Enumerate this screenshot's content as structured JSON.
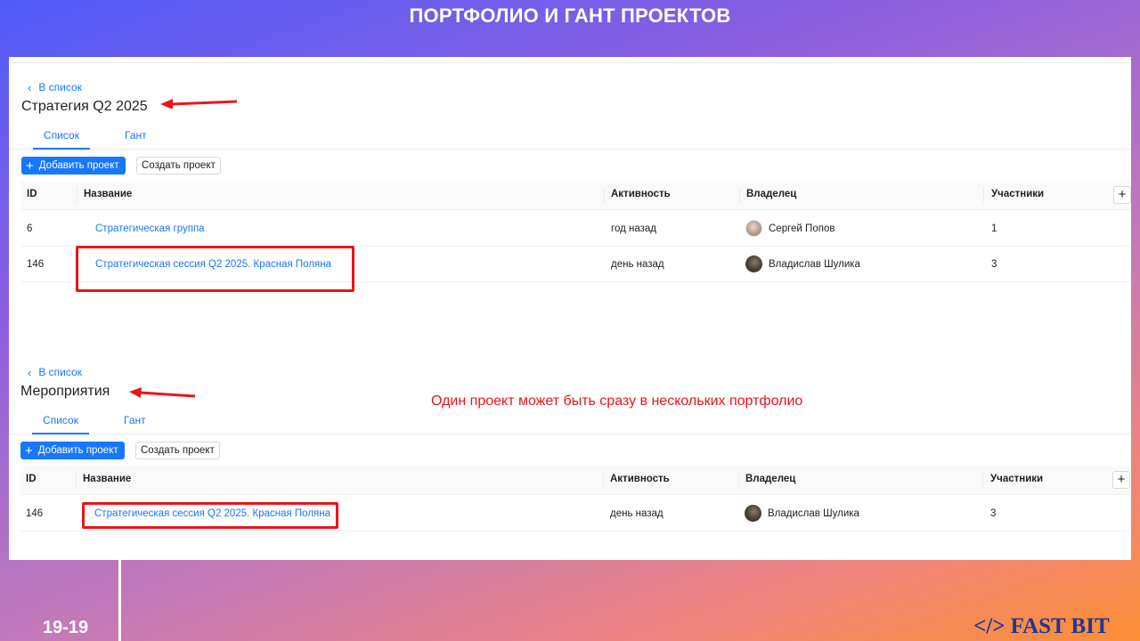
{
  "slide": {
    "title": "ПОРТФОЛИО И ГАНТ ПРОЕКТОВ",
    "page_number": "19-19",
    "brand": "</> FAST BIT",
    "note": "Один проект может быть сразу в нескольких портфолио"
  },
  "table_columns": {
    "id": "ID",
    "name": "Название",
    "activity": "Активность",
    "owner": "Владелец",
    "participants": "Участники",
    "add_column": "+"
  },
  "sections": [
    {
      "back_label": "В список",
      "title": "Стратегия Q2 2025",
      "tabs": [
        {
          "label": "Список",
          "active": true
        },
        {
          "label": "Гант",
          "active": false
        }
      ],
      "add_project_label": "Добавить проект",
      "create_project_label": "Создать проект",
      "rows": [
        {
          "id": "6",
          "name": "Стратегическая группа",
          "activity": "год назад",
          "owner": "Сергей Попов",
          "owner_avatar": "light",
          "participants": "1"
        },
        {
          "id": "146",
          "name": "Стратегическая сессия Q2 2025. Красная Поляна",
          "activity": "день назад",
          "owner": "Владислав Шулика",
          "owner_avatar": "dark",
          "participants": "3"
        }
      ]
    },
    {
      "back_label": "В список",
      "title": "Мероприятия",
      "tabs": [
        {
          "label": "Список",
          "active": true
        },
        {
          "label": "Гант",
          "active": false
        }
      ],
      "add_project_label": "Добавить проект",
      "create_project_label": "Создать проект",
      "rows": [
        {
          "id": "146",
          "name": "Стратегическая сессия Q2 2025. Красная Поляна",
          "activity": "день назад",
          "owner": "Владислав Шулика",
          "owner_avatar": "dark",
          "participants": "3"
        }
      ]
    }
  ],
  "colors": {
    "accent": "#1677ff",
    "highlight_red": "#e8161b",
    "brand_blue": "#24368f"
  }
}
